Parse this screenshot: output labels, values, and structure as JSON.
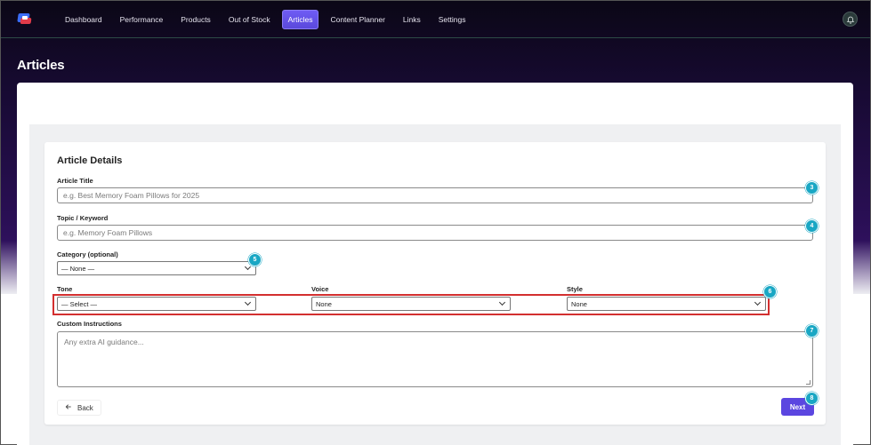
{
  "nav": {
    "items": [
      {
        "label": "Dashboard"
      },
      {
        "label": "Performance"
      },
      {
        "label": "Products"
      },
      {
        "label": "Out of Stock"
      },
      {
        "label": "Articles",
        "active": true
      },
      {
        "label": "Content Planner"
      },
      {
        "label": "Links"
      },
      {
        "label": "Settings"
      }
    ]
  },
  "page": {
    "title": "Articles"
  },
  "form": {
    "section_title": "Article Details",
    "article_title": {
      "label": "Article Title",
      "placeholder": "e.g. Best Memory Foam Pillows for 2025"
    },
    "topic": {
      "label": "Topic / Keyword",
      "placeholder": "e.g. Memory Foam Pillows"
    },
    "category": {
      "label": "Category (optional)",
      "value": "— None —"
    },
    "tone": {
      "label": "Tone",
      "value": "— Select —"
    },
    "voice": {
      "label": "Voice",
      "value": "None"
    },
    "style": {
      "label": "Style",
      "value": "None"
    },
    "instructions": {
      "label": "Custom Instructions",
      "placeholder": "Any extra AI guidance..."
    },
    "back_label": "Back",
    "next_label": "Next"
  },
  "badges": [
    "3",
    "4",
    "5",
    "6",
    "7",
    "8"
  ],
  "colors": {
    "accent": "#5b46e0",
    "badge": "#19a7c4",
    "highlight": "#d32f2f"
  }
}
